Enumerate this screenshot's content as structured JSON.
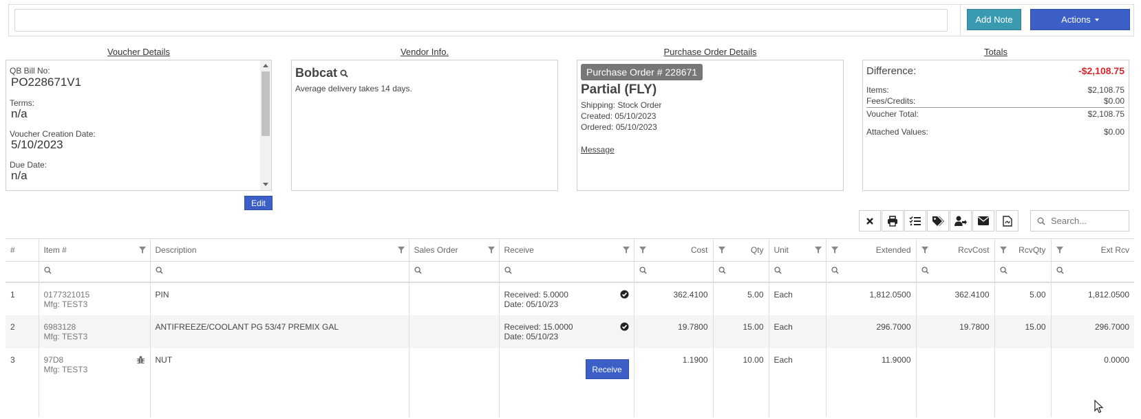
{
  "topbar": {
    "note_placeholder": "",
    "add_note_label": "Add Note",
    "actions_label": "Actions"
  },
  "sections": {
    "voucher_title": "Voucher Details",
    "vendor_title": "Vendor Info.",
    "po_title": "Purchase Order Details",
    "totals_title": "Totals"
  },
  "voucher": {
    "fields": [
      {
        "label": "QB Bill No:",
        "value": "PO228671V1"
      },
      {
        "label": "Terms:",
        "value": "n/a"
      },
      {
        "label": "Voucher Creation Date:",
        "value": "5/10/2023"
      },
      {
        "label": "Due Date:",
        "value": "n/a"
      }
    ],
    "edit_label": "Edit"
  },
  "vendor": {
    "name": "Bobcat",
    "delivery_note": "Average delivery takes 14 days."
  },
  "po": {
    "badge": "Purchase Order # 228671",
    "status": "Partial (FLY)",
    "shipping": "Shipping: Stock Order",
    "created": "Created: 05/10/2023",
    "ordered": "Ordered: 05/10/2023",
    "message_link": "Message"
  },
  "totals": {
    "difference_label": "Difference:",
    "difference_value": "-$2,108.75",
    "items_label": "Items:",
    "items_value": "$2,108.75",
    "fees_label": "Fees/Credits:",
    "fees_value": "$0.00",
    "voucher_total_label": "Voucher Total:",
    "voucher_total_value": "$2,108.75",
    "attached_label": "Attached Values:",
    "attached_value": "$0.00",
    "difference_color": "#d9252a"
  },
  "toolbar": {
    "icons": [
      "close-icon",
      "print-icon",
      "checklist-icon",
      "tags-icon",
      "user-assign-icon",
      "envelope-icon",
      "export-pdf-icon"
    ],
    "search_placeholder": "Search..."
  },
  "grid": {
    "columns": [
      "#",
      "Item #",
      "Description",
      "Sales Order",
      "Receive",
      "Cost",
      "Qty",
      "Unit",
      "Extended",
      "RcvCost",
      "RcvQty",
      "Ext Rcv"
    ],
    "rows": [
      {
        "num": "1",
        "item": "0177321015",
        "mfg": "Mfg: TEST3",
        "description": "PIN",
        "sales_order": "",
        "received": "Received: 5.0000",
        "date": "Date: 05/10/23",
        "cost": "362.4100",
        "qty": "5.00",
        "unit": "Each",
        "extended": "1,812.0500",
        "rcv_cost": "362.4100",
        "rcv_qty": "5.00",
        "ext_rcv": "1,812.0500"
      },
      {
        "num": "2",
        "item": "6983128",
        "mfg": "Mfg: TEST3",
        "description": "ANTIFREEZE/COOLANT PG 53/47 PREMIX GAL",
        "sales_order": "",
        "received": "Received: 15.0000",
        "date": "Date: 05/10/23",
        "cost": "19.7800",
        "qty": "15.00",
        "unit": "Each",
        "extended": "296.7000",
        "rcv_cost": "19.7800",
        "rcv_qty": "15.00",
        "ext_rcv": "296.7000"
      },
      {
        "num": "3",
        "item": "97D8",
        "mfg": "Mfg: TEST3",
        "description": "NUT",
        "sales_order": "",
        "receive_button": "Receive",
        "cost": "1.1900",
        "qty": "10.00",
        "unit": "Each",
        "extended": "11.9000",
        "rcv_cost": "",
        "rcv_qty": "",
        "ext_rcv": "0.0000"
      }
    ]
  }
}
